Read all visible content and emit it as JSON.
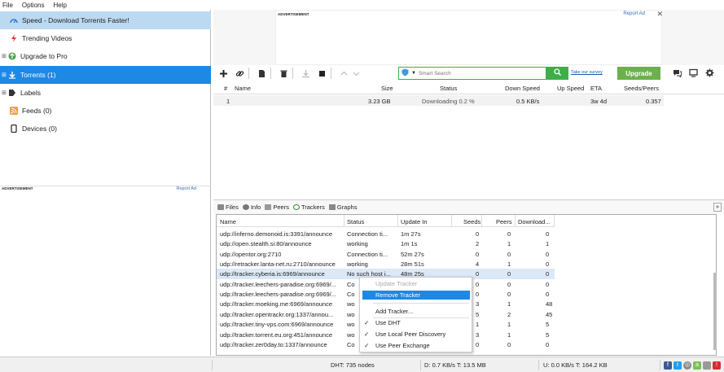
{
  "menu": [
    "File",
    "Options",
    "Help"
  ],
  "sidebar": {
    "items": [
      {
        "label": "Speed - Download Torrents Faster!"
      },
      {
        "label": "Trending Videos"
      },
      {
        "label": "Upgrade to Pro"
      },
      {
        "label": "Torrents (1)"
      },
      {
        "label": "Labels"
      },
      {
        "label": "Feeds (0)"
      },
      {
        "label": "Devices (0)"
      }
    ],
    "ad_label": "ADVERTISEMENT",
    "report_ad": "Report Ad"
  },
  "top_ad": {
    "label": "ADVERTISEMENT",
    "report_ad": "Report Ad",
    "close": "✕"
  },
  "toolbar": {
    "search_placeholder": "Smart Search",
    "survey": "Take our survey",
    "upgrade": "Upgrade"
  },
  "torrents": {
    "columns": [
      "#",
      "Name",
      "Size",
      "Status",
      "Down Speed",
      "Up Speed",
      "ETA",
      "Seeds/Peers"
    ],
    "rows": [
      {
        "num": "1",
        "name": "",
        "size": "3.23 GB",
        "status": "Downloading 0.2 %",
        "down": "0.5 KB/s",
        "up": "",
        "eta": "3w 4d",
        "seeds": "0.357"
      }
    ]
  },
  "tabs": [
    "Files",
    "Info",
    "Peers",
    "Trackers",
    "Graphs"
  ],
  "trackers": {
    "columns": [
      "Name",
      "Status",
      "Update In",
      "Seeds",
      "Peers",
      "Download..."
    ],
    "rows": [
      {
        "name": "udp://inferno.demonoid.is:3391/announce",
        "status": "Connection ti...",
        "update": "1m 27s",
        "seeds": "0",
        "peers": "0",
        "dl": "0"
      },
      {
        "name": "udp://open.stealth.si:80/announce",
        "status": "working",
        "update": "1m 1s",
        "seeds": "2",
        "peers": "1",
        "dl": "1"
      },
      {
        "name": "udp://opentor.org:2710",
        "status": "Connection ti...",
        "update": "52m 27s",
        "seeds": "0",
        "peers": "0",
        "dl": "0"
      },
      {
        "name": "udp://retracker.lanta-net.ru:2710/announce",
        "status": "working",
        "update": "28m 51s",
        "seeds": "4",
        "peers": "1",
        "dl": "0"
      },
      {
        "name": "udp://tracker.cyberia.is:6969/announce",
        "status": "No such host i...",
        "update": "48m 25s",
        "seeds": "0",
        "peers": "0",
        "dl": "0"
      },
      {
        "name": "udp://tracker.leechers-paradise.org:6969/...",
        "status": "Co",
        "update": "",
        "seeds": "0",
        "peers": "0",
        "dl": "0"
      },
      {
        "name": "udp://tracker.leechers-paradise.org:6969/...",
        "status": "Co",
        "update": "",
        "seeds": "0",
        "peers": "0",
        "dl": "0"
      },
      {
        "name": "udp://tracker.moeking.me:6969/announce",
        "status": "wo",
        "update": "",
        "seeds": "3",
        "peers": "1",
        "dl": "48"
      },
      {
        "name": "udp://tracker.opentrackr.org:1337/annou...",
        "status": "wo",
        "update": "",
        "seeds": "5",
        "peers": "2",
        "dl": "45"
      },
      {
        "name": "udp://tracker.tiny-vps.com:6969/announce",
        "status": "wo",
        "update": "",
        "seeds": "1",
        "peers": "1",
        "dl": "5"
      },
      {
        "name": "udp://tracker.torrent.eu.org:451/announce",
        "status": "wo",
        "update": "",
        "seeds": "3",
        "peers": "1",
        "dl": "5"
      },
      {
        "name": "udp://tracker.zer0day.to:1337/announce",
        "status": "Co",
        "update": "",
        "seeds": "0",
        "peers": "0",
        "dl": "0"
      }
    ]
  },
  "context_menu": {
    "items": [
      "Update Tracker",
      "Remove Tracker",
      "Add Tracker...",
      "Use DHT",
      "Use Local Peer Discovery",
      "Use Peer Exchange"
    ]
  },
  "status": {
    "dht": "DHT: 735 nodes",
    "down": "D: 0.7 KB/s T: 13.5 MB",
    "up": "U: 0.0 KB/s T: 164.2 KB"
  },
  "colors": {
    "accent": "#1e88e5",
    "green": "#3fae49",
    "upgrade": "#6cb14c"
  }
}
